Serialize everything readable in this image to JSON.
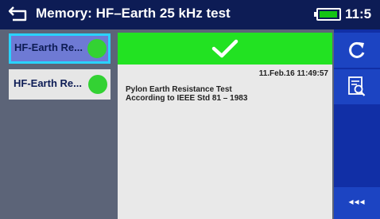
{
  "header": {
    "title": "Memory: HF–Earth 25 kHz test",
    "time": "11:5",
    "battery_icon": "battery-full-icon",
    "back_icon": "back-arrow-icon"
  },
  "list": {
    "items": [
      {
        "label": "HF-Earth Re...",
        "status": "pass",
        "selected": true
      },
      {
        "label": "HF-Earth Re...",
        "status": "pass",
        "selected": false
      }
    ]
  },
  "detail": {
    "status_icon": "check-icon",
    "datetime": "11.Feb.16 11:49:57",
    "line1": "Pylon Earth Resistance Test",
    "line2": "According to IEEE Std 81 – 1983"
  },
  "sidebar": {
    "refresh_icon": "refresh-icon",
    "report_icon": "report-search-icon",
    "more_label": "◂◂◂"
  },
  "colors": {
    "header_bg": "#0d1c55",
    "pass_green": "#22e222",
    "selected_item": "#6e7ad4",
    "sidebar_bg": "#112fa6"
  }
}
